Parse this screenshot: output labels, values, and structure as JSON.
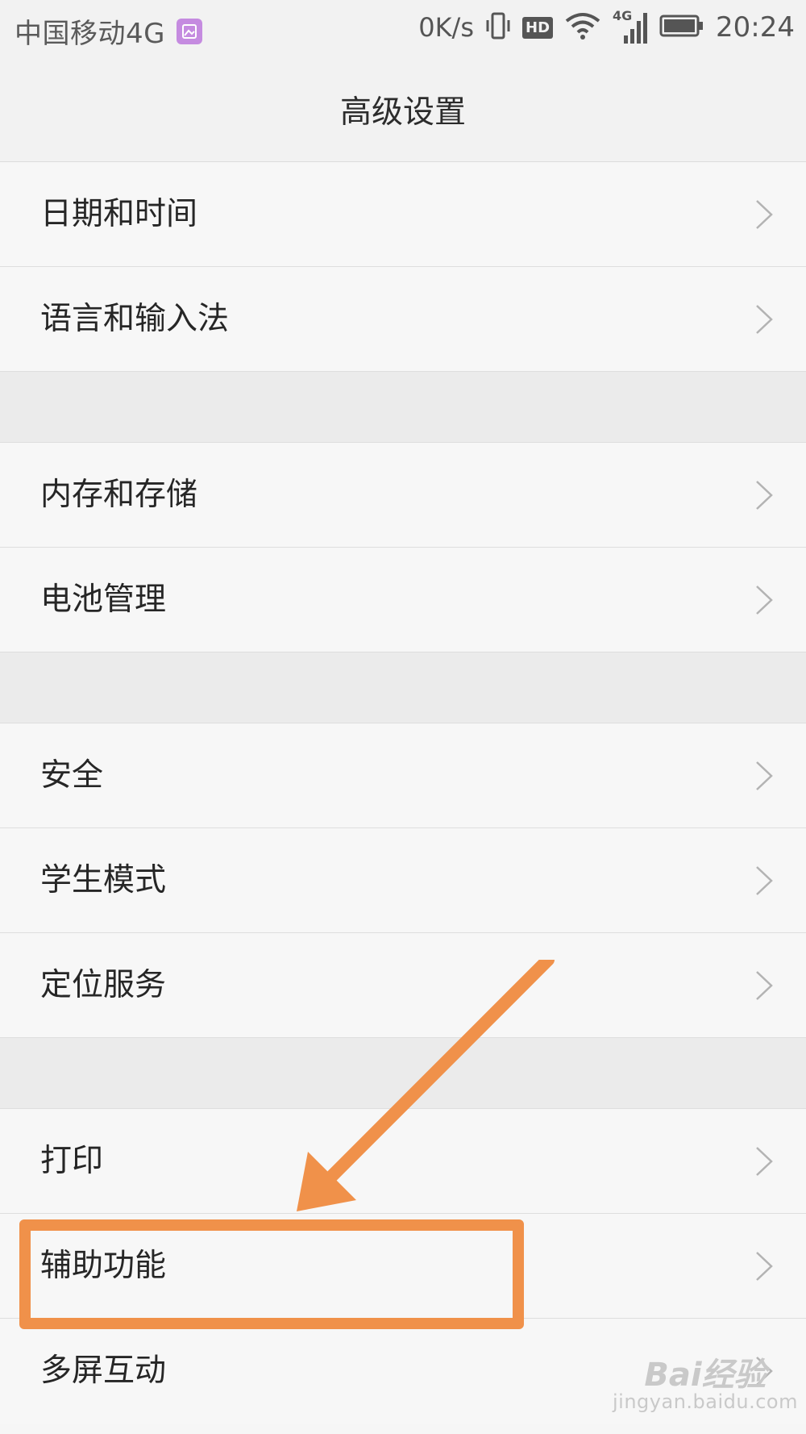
{
  "status_bar": {
    "carrier": "中国移动4G",
    "speed": "0K/s",
    "hd": "HD",
    "network": "4G",
    "time": "20:24"
  },
  "header": {
    "title": "高级设置"
  },
  "sections": [
    {
      "items": [
        {
          "label": "日期和时间"
        },
        {
          "label": "语言和输入法"
        }
      ]
    },
    {
      "items": [
        {
          "label": "内存和存储"
        },
        {
          "label": "电池管理"
        }
      ]
    },
    {
      "items": [
        {
          "label": "安全"
        },
        {
          "label": "学生模式"
        },
        {
          "label": "定位服务"
        }
      ]
    },
    {
      "items": [
        {
          "label": "打印"
        },
        {
          "label": "辅助功能"
        },
        {
          "label": "多屏互动"
        }
      ]
    }
  ],
  "annotation": {
    "highlighted_item": "辅助功能",
    "color": "#f0914a"
  },
  "watermark": {
    "brand": "Bai经验",
    "url": "jingyan.baidu.com"
  },
  "colors": {
    "accent_gallery": "#c58be0",
    "highlight": "#f0914a"
  }
}
